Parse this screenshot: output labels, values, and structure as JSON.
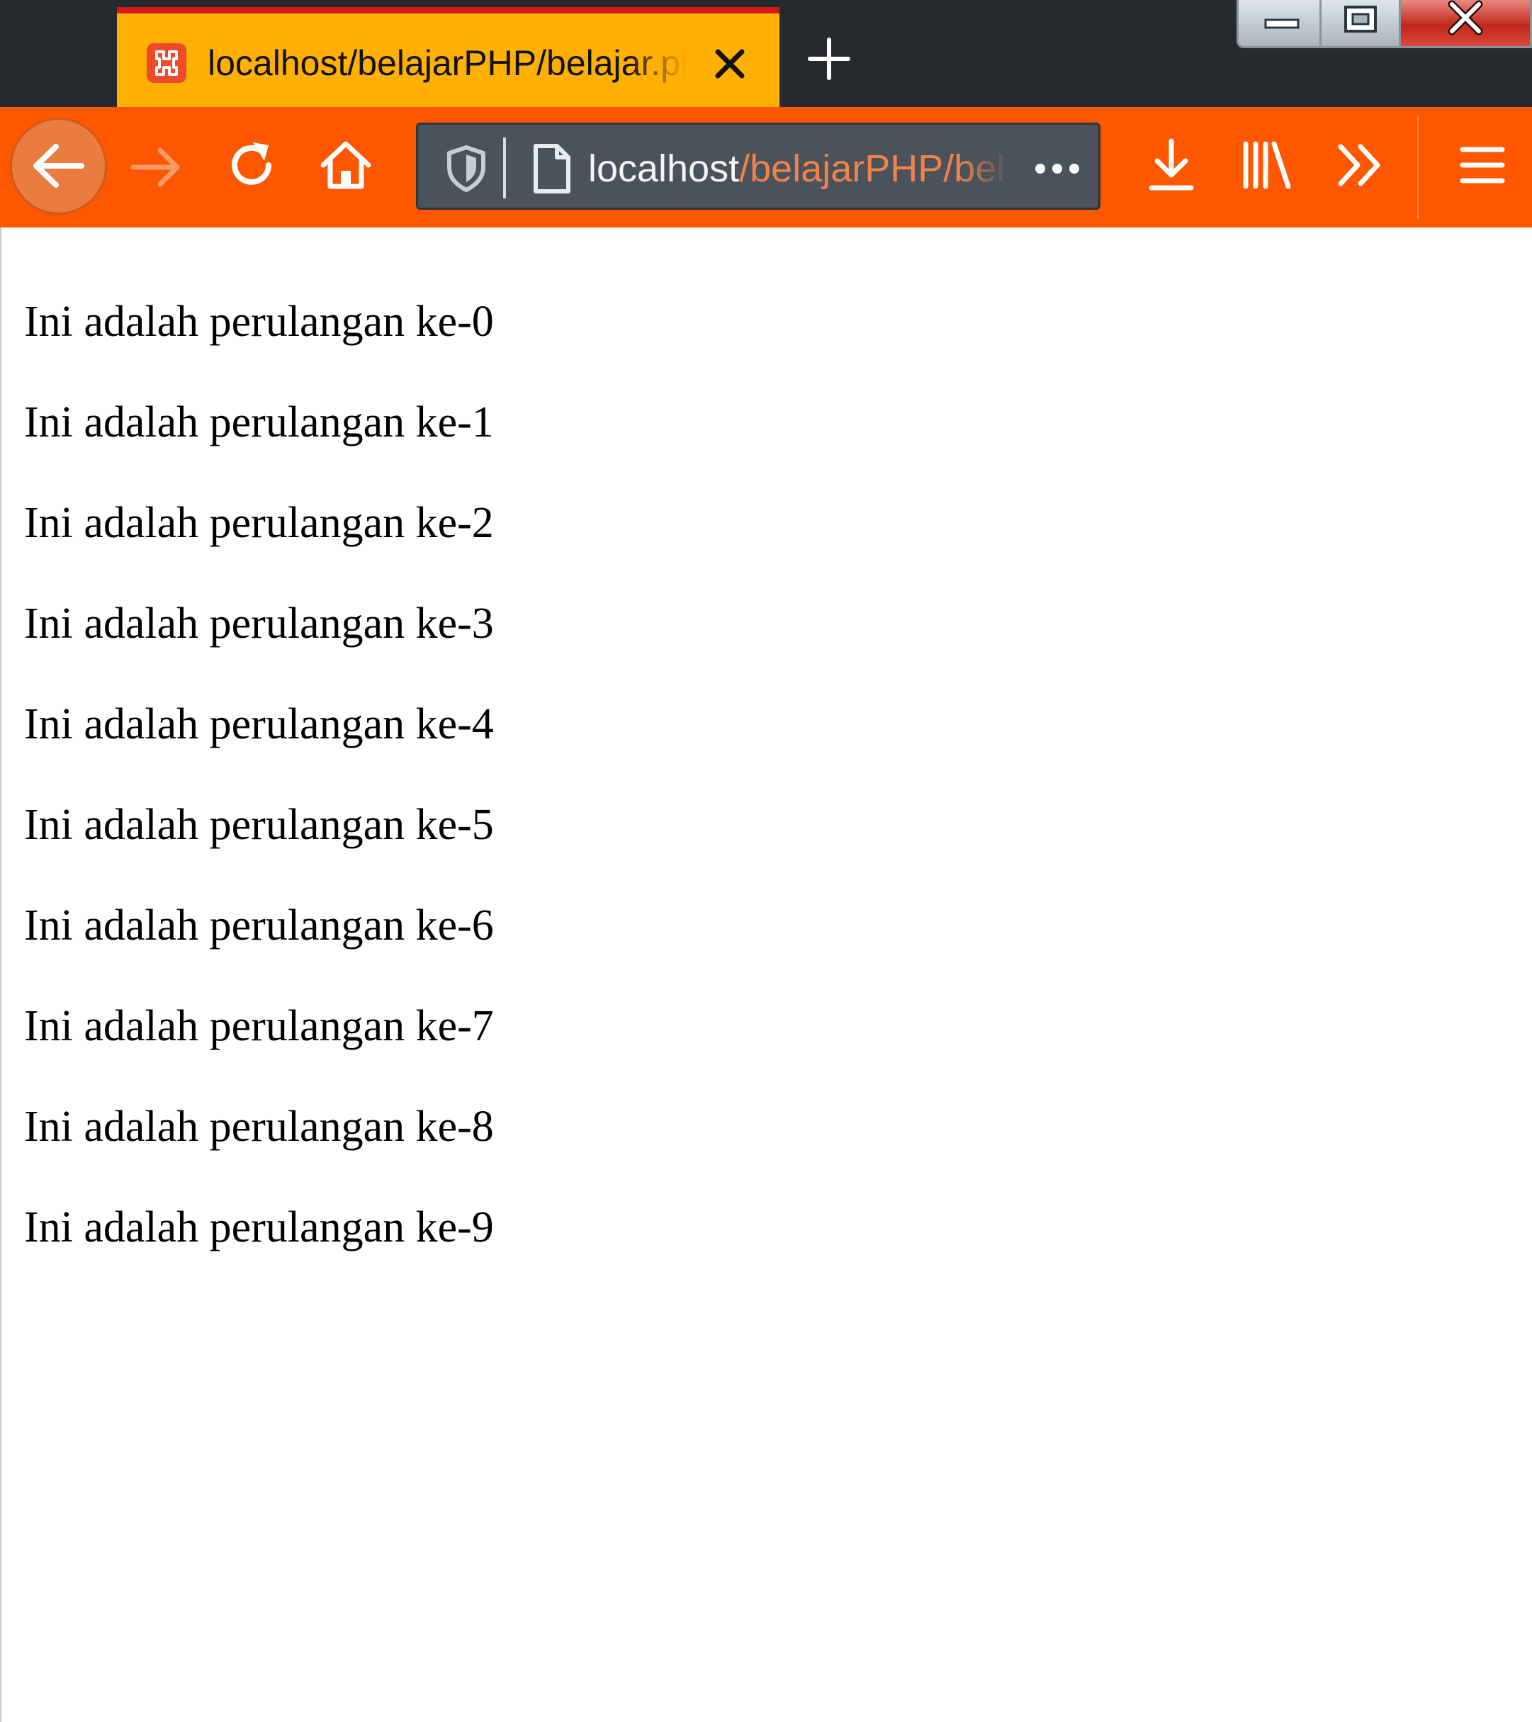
{
  "browser": {
    "tab": {
      "title": "localhost/belajarPHP/belajar.php",
      "favicon": "xampp-icon"
    },
    "address_bar": {
      "host": "localhost",
      "path": "/belajarPHP/belajar.php"
    },
    "colors": {
      "tab_strip": "#252a2f",
      "active_tab": "#ffb000",
      "toolbar": "#ff5700",
      "urlbar": "#4a535c",
      "url_path": "#f0824a"
    }
  },
  "page": {
    "lines": [
      "Ini adalah perulangan ke-0",
      "Ini adalah perulangan ke-1",
      "Ini adalah perulangan ke-2",
      "Ini adalah perulangan ke-3",
      "Ini adalah perulangan ke-4",
      "Ini adalah perulangan ke-5",
      "Ini adalah perulangan ke-6",
      "Ini adalah perulangan ke-7",
      "Ini adalah perulangan ke-8",
      "Ini adalah perulangan ke-9"
    ]
  }
}
